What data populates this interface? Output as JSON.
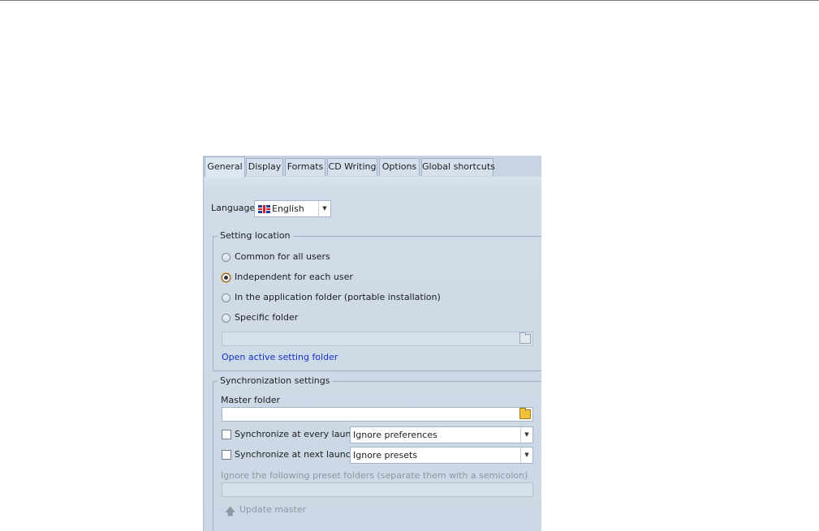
{
  "tabs": [
    {
      "label": "General",
      "active": true
    },
    {
      "label": "Display"
    },
    {
      "label": "Formats"
    },
    {
      "label": "CD Writing"
    },
    {
      "label": "Options"
    },
    {
      "label": "Global shortcuts"
    }
  ],
  "language": {
    "label": "Language",
    "selected": "English",
    "flag_icon": "uk-flag-icon"
  },
  "setting_location": {
    "legend": "Setting location",
    "options": [
      {
        "label": "Common for all users",
        "checked": false
      },
      {
        "label": "Independent for each user",
        "checked": true
      },
      {
        "label": "In the application folder (portable installation)",
        "checked": false
      },
      {
        "label": "Specific folder",
        "checked": false
      }
    ],
    "folder_path": "",
    "open_link": "Open active setting folder"
  },
  "sync": {
    "legend": "Synchronization settings",
    "master_folder_label": "Master folder",
    "master_folder_value": "",
    "every_launch_label": "Synchronize at every launch",
    "every_launch_checked": false,
    "every_launch_option": "Ignore preferences",
    "next_launch_label": "Synchronize at next launch",
    "next_launch_checked": false,
    "next_launch_option": "Ignore presets",
    "ignore_folders_label": "Ignore the following preset folders (separate them with a semicolon)",
    "ignore_folders_value": "",
    "update_master_label": "Update master"
  },
  "colors": {
    "panel_bg": "#cdd9e6",
    "link": "#1432c8",
    "radio_focus": "#e7a43a",
    "folder": "#f3c23a"
  }
}
